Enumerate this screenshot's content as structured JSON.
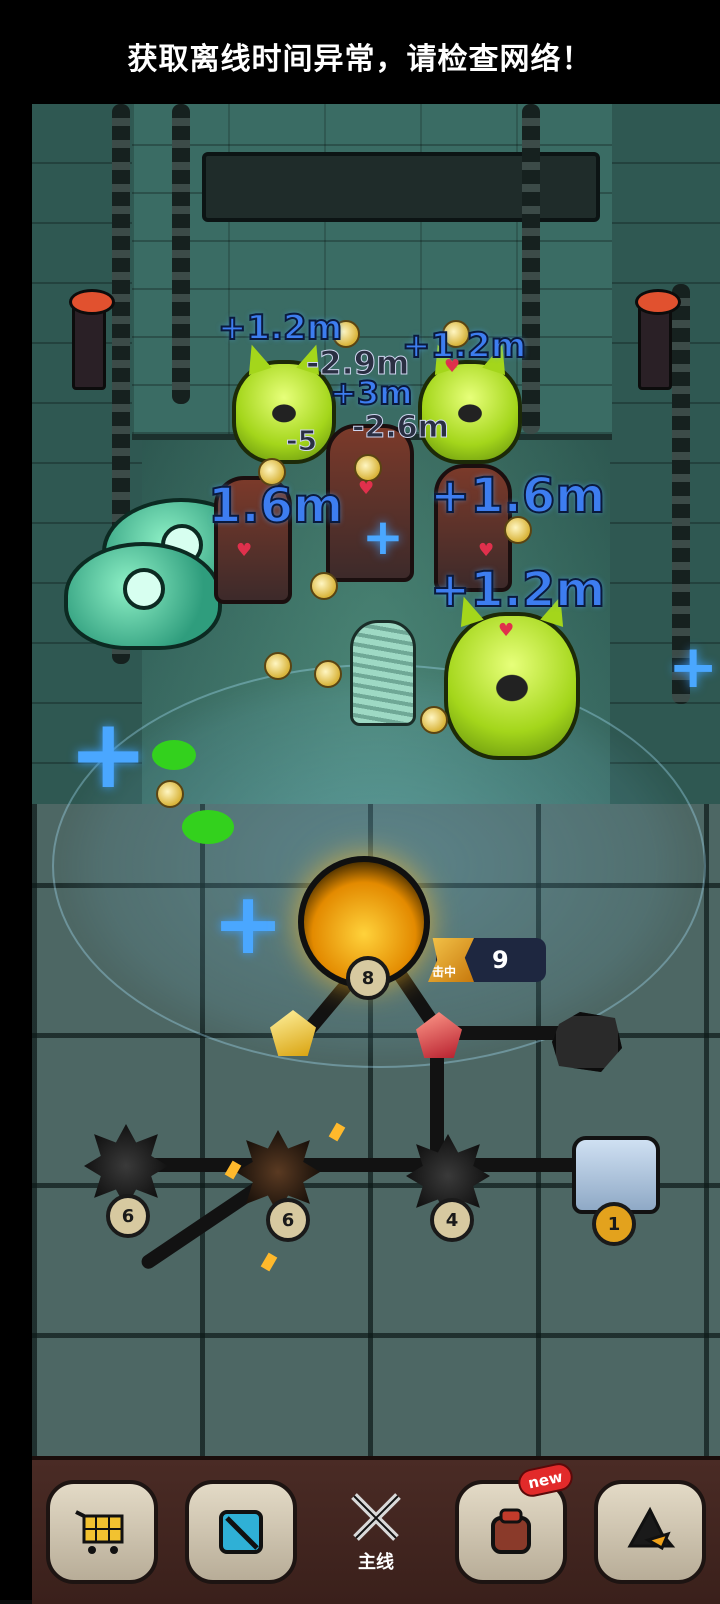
{
  "status_notice": "获取离线时间异常，请检查网络！",
  "combat": {
    "damage_numbers": [
      {
        "text": "+1.2m",
        "kind": "heal"
      },
      {
        "text": "+1.2m",
        "kind": "heal"
      },
      {
        "text": "-2.9m",
        "kind": "damage"
      },
      {
        "text": "+3m",
        "kind": "heal"
      },
      {
        "text": "-5",
        "kind": "damage"
      },
      {
        "text": "-2.6m",
        "kind": "damage"
      },
      {
        "text": "1.6m",
        "kind": "heal"
      },
      {
        "text": "+1.6m",
        "kind": "heal"
      },
      {
        "text": "+1.2m",
        "kind": "heal"
      }
    ]
  },
  "path_board": {
    "core_level": "8",
    "hit_label": "击中",
    "hit_count": "9",
    "nodes": [
      {
        "name": "left-spike",
        "level": "6"
      },
      {
        "name": "fire-spike",
        "level": "6"
      },
      {
        "name": "mid-spike",
        "level": "4"
      },
      {
        "name": "fist",
        "level": "1"
      }
    ]
  },
  "bottom_nav": {
    "items": [
      {
        "icon": "shop-cart-icon"
      },
      {
        "icon": "pickaxe-icon"
      },
      {
        "icon": "crossed-swords-icon",
        "label": "主线"
      },
      {
        "icon": "backpack-icon",
        "badge": "new"
      },
      {
        "icon": "hat-icon"
      }
    ]
  }
}
